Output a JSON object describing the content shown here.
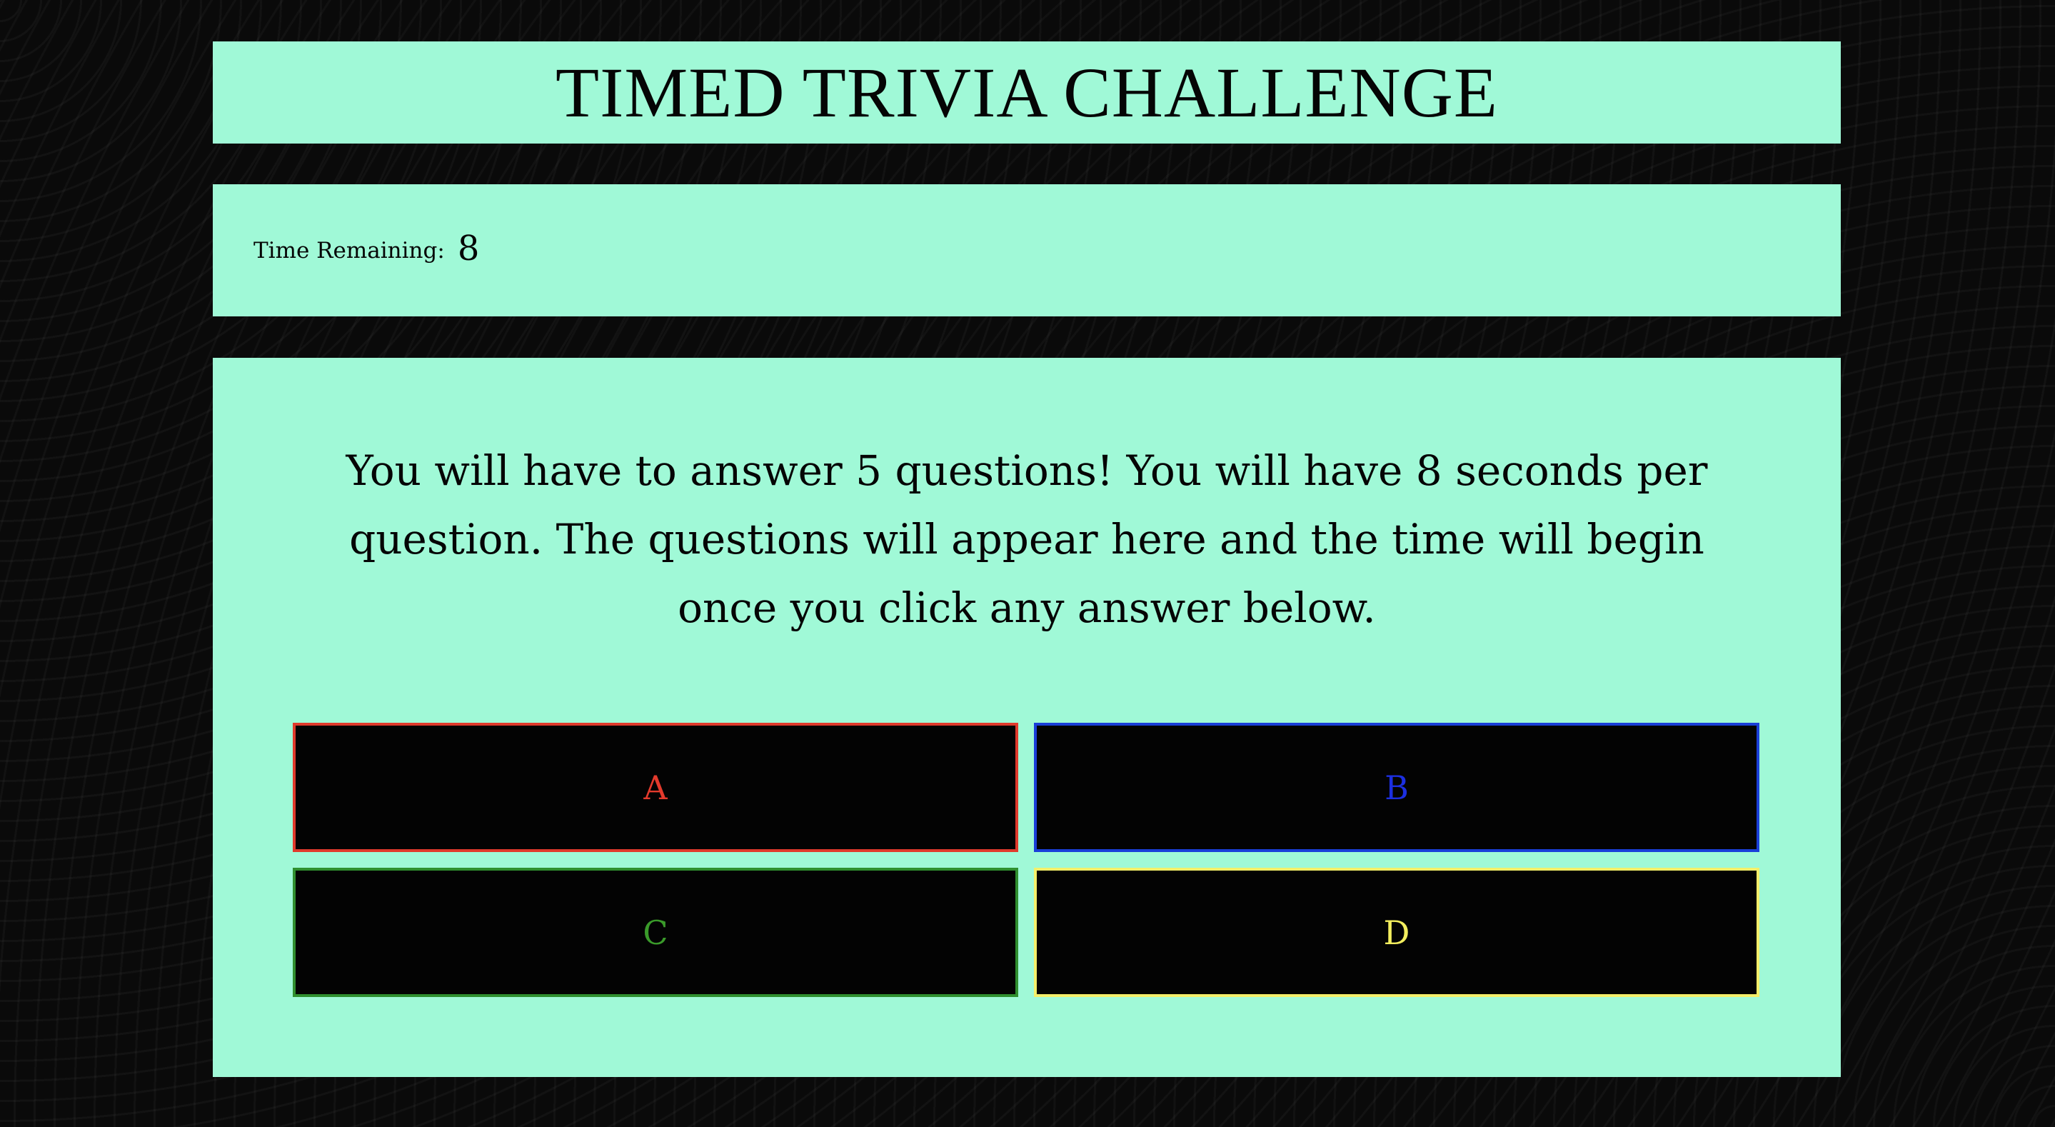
{
  "header": {
    "title": "TIMED TRIVIA CHALLENGE"
  },
  "timer": {
    "label": "Time Remaining:",
    "value": "8"
  },
  "quiz": {
    "instructions": "You will have to answer 5 questions! You will have 8 seconds per question. The questions will appear here and the time will begin once you click any answer below.",
    "answers": [
      {
        "label": "A",
        "color": "#e33a2c"
      },
      {
        "label": "B",
        "color": "#1c2fe0"
      },
      {
        "label": "C",
        "color": "#3a9a2a"
      },
      {
        "label": "D",
        "color": "#f3ee5e"
      }
    ]
  },
  "colors": {
    "panel_background": "#a0f9d7",
    "page_background": "#0a0a0a",
    "button_background": "#030303"
  }
}
